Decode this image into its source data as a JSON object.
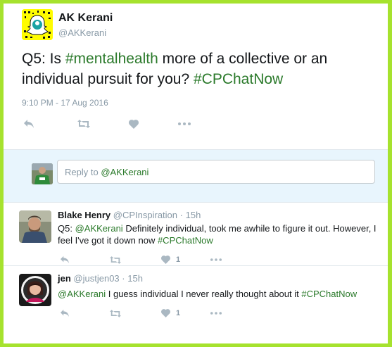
{
  "main_tweet": {
    "author_name": "AK Kerani",
    "author_handle": "@AKKerani",
    "text_prefix": "Q5: Is ",
    "hashtag_1": "#mentalhealth",
    "text_middle": " more of a collective or an individual pursuit for you? ",
    "hashtag_2": "#CPChatNow",
    "timestamp": "9:10 PM - 17 Aug 2016",
    "actions": [
      "reply-icon",
      "retweet-icon",
      "like-icon",
      "more-icon"
    ]
  },
  "reply_box": {
    "placeholder_prefix": "Reply to ",
    "placeholder_mention": "@AKKerani"
  },
  "replies": [
    {
      "name": "Blake Henry",
      "handle": "@CPInspiration",
      "time": "15h",
      "text_prefix": "Q5: ",
      "mention": "@AKKerani",
      "text_middle": " Definitely individual, took me awhile to figure it out. However, I feel I've got it down now ",
      "hashtag": "#CPChatNow",
      "like_count": "1"
    },
    {
      "name": "jen",
      "handle": "@justjen03",
      "time": "15h",
      "text_prefix": "",
      "mention": "@AKKerani",
      "text_middle": " I guess individual I never really thought about it ",
      "hashtag": "#CPChatNow",
      "like_count": "1"
    }
  ],
  "colors": {
    "border": "#a6e22e",
    "link": "#2b7a2b",
    "reply_box_bg": "#e8f5fd",
    "snapchat_yellow": "#fffc00"
  }
}
